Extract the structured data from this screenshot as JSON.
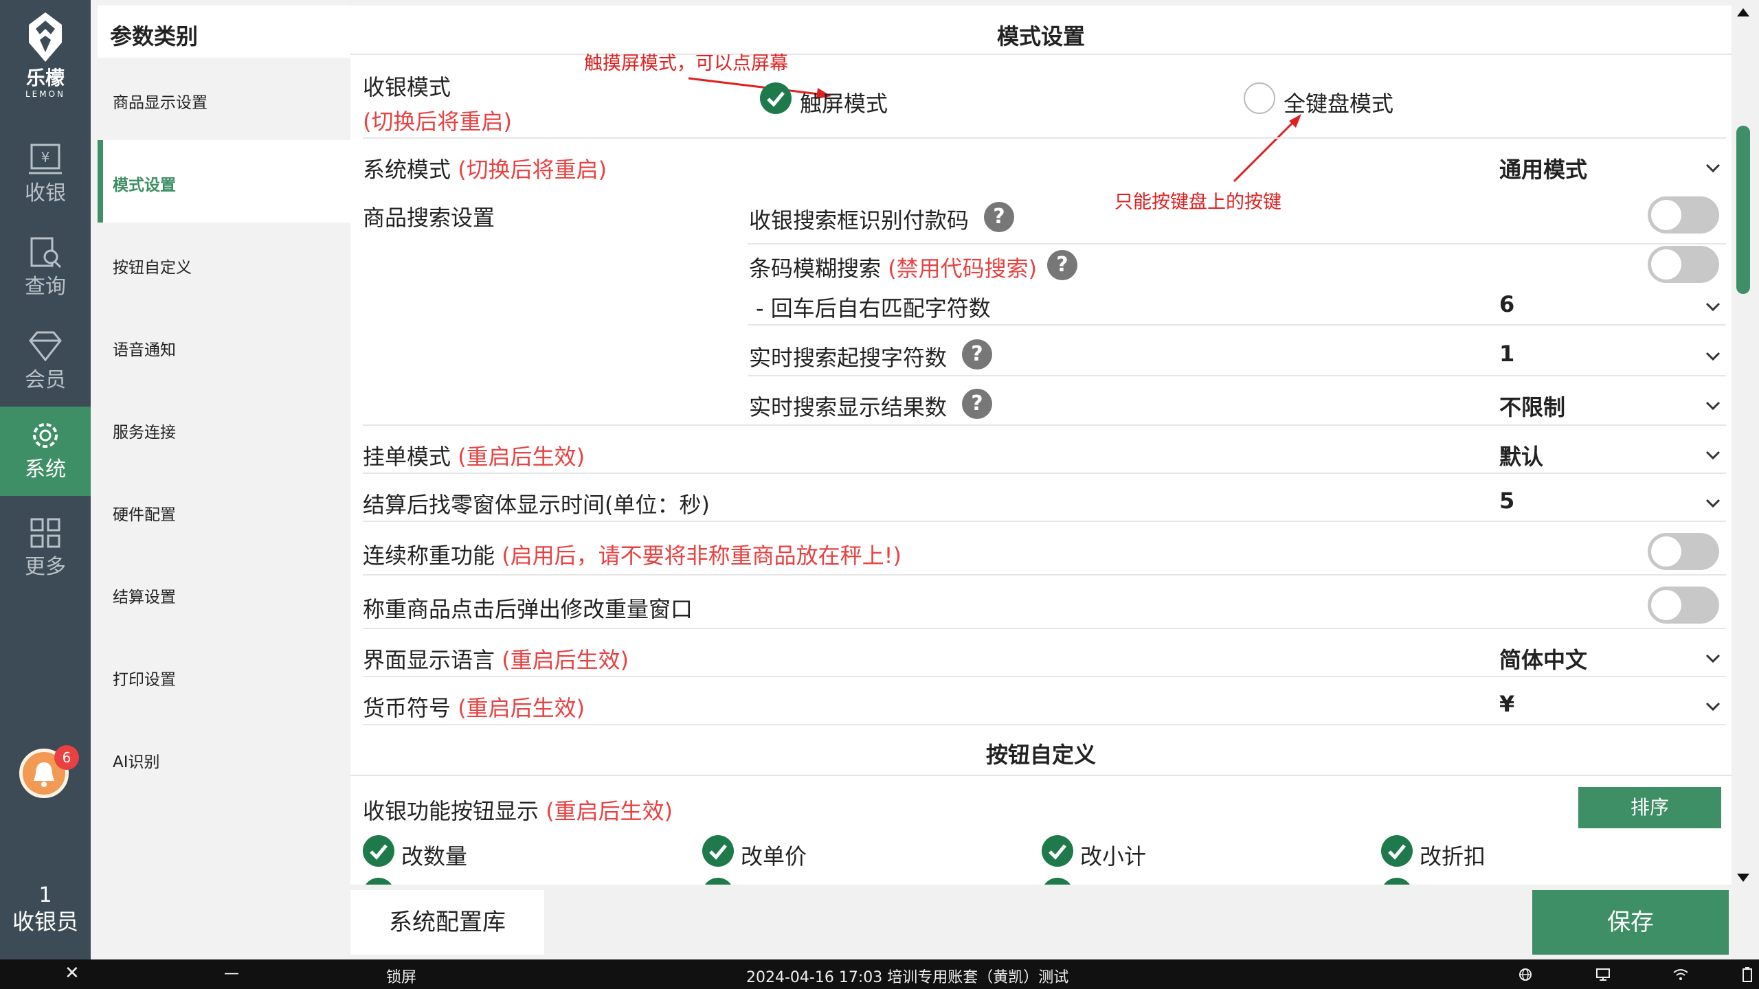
{
  "app": {
    "logo_name": "乐檬",
    "logo_sub": "LEMON"
  },
  "nav": {
    "items": [
      {
        "label": "收银",
        "icon": "cashier-icon"
      },
      {
        "label": "查询",
        "icon": "query-icon"
      },
      {
        "label": "会员",
        "icon": "member-icon"
      },
      {
        "label": "系统",
        "icon": "gear-icon",
        "active": true
      },
      {
        "label": "更多",
        "icon": "grid-icon"
      }
    ],
    "notification_count": "6",
    "cashier_id": "1",
    "cashier_label": "收银员"
  },
  "categories": {
    "title": "参数类别",
    "items": [
      {
        "label": "商品显示设置"
      },
      {
        "label": "模式设置",
        "active": true
      },
      {
        "label": "按钮自定义"
      },
      {
        "label": "语音通知"
      },
      {
        "label": "服务连接"
      },
      {
        "label": "硬件配置"
      },
      {
        "label": "结算设置"
      },
      {
        "label": "打印设置"
      },
      {
        "label": "AI识别"
      }
    ]
  },
  "mode_settings": {
    "title": "模式设置",
    "cashier_mode": {
      "label": "收银模式",
      "note": "(切换后将重启)",
      "option_touch": "触屏模式",
      "option_keyboard": "全键盘模式",
      "selected": "触屏模式"
    },
    "annotations": {
      "touch": "触摸屏模式，可以点屏幕",
      "keyboard": "只能按键盘上的按键"
    },
    "system_mode": {
      "label": "系统模式",
      "note": "(切换后将重启)",
      "value": "通用模式"
    },
    "search": {
      "label": "商品搜索设置",
      "payment_code": {
        "label": "收银搜索框识别付款码",
        "on": false
      },
      "fuzzy_barcode": {
        "label": "条码模糊搜索",
        "note": "(禁用代码搜索)",
        "on": false
      },
      "enter_match": {
        "label": "- 回车后自右匹配字符数",
        "value": "6"
      },
      "realtime_start": {
        "label": "实时搜索起搜字符数",
        "value": "1"
      },
      "realtime_results": {
        "label": "实时搜索显示结果数",
        "value": "不限制"
      }
    },
    "hang_mode": {
      "label": "挂单模式",
      "note": "(重启后生效)",
      "value": "默认"
    },
    "change_window": {
      "label": "结算后找零窗体显示时间(单位：秒)",
      "value": "5"
    },
    "continuous_weigh": {
      "label": "连续称重功能",
      "note": "(启用后，请不要将非称重商品放在秤上!)",
      "on": false
    },
    "weigh_popup": {
      "label": "称重商品点击后弹出修改重量窗口",
      "on": false
    },
    "language": {
      "label": "界面显示语言",
      "note": "(重启后生效)",
      "value": "简体中文"
    },
    "currency": {
      "label": "货币符号",
      "note": "(重启后生效)",
      "value": "¥"
    }
  },
  "button_custom": {
    "title": "按钮自定义",
    "function_buttons": {
      "label": "收银功能按钮显示",
      "note": "(重启后生效)",
      "sort_label": "排序"
    },
    "checks": [
      {
        "label": "改数量",
        "checked": true
      },
      {
        "label": "改单价",
        "checked": true
      },
      {
        "label": "改小计",
        "checked": true
      },
      {
        "label": "改折扣",
        "checked": true
      }
    ]
  },
  "footer": {
    "config_btn": "系统配置库",
    "save_btn": "保存"
  },
  "statusbar": {
    "close": "✕",
    "minimize": "—",
    "lock": "锁屏",
    "info": "2024-04-16 17:03 培训专用账套（黄凯）测试"
  },
  "colors": {
    "accent": "#3e8e66",
    "nav_bg": "#3d4b56",
    "warning": "#e94141",
    "annotation": "#e02020"
  }
}
